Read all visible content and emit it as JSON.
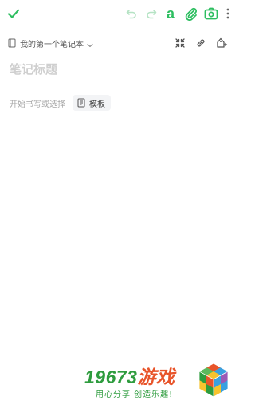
{
  "toolbar": {
    "done_icon": "check-icon",
    "undo_icon": "undo-icon",
    "redo_icon": "redo-icon",
    "format_label": "a",
    "attach_icon": "paperclip-icon",
    "camera_icon": "camera-icon",
    "more_icon": "more-vertical-icon",
    "accent_color": "#2dbe60",
    "disabled_color": "#b5e3c4"
  },
  "notebook": {
    "name": "我的第一个笔记本",
    "icons": [
      "notebook-icon",
      "chevron-down-icon",
      "collapse-icon",
      "link-icon",
      "tag-icon"
    ]
  },
  "note": {
    "title_placeholder": "笔记标题",
    "title_value": "",
    "body_hint": "开始书写或选择",
    "template_label": "模板"
  },
  "watermark": {
    "number": "19673",
    "brand": "游戏",
    "slogan": "用心分享 创造乐趣!"
  }
}
